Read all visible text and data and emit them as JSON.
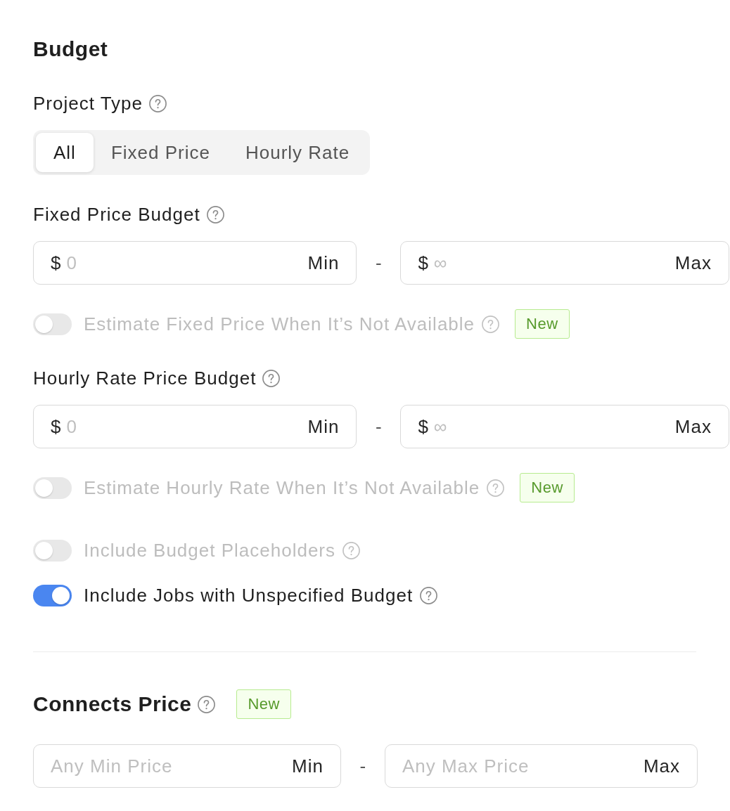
{
  "sections": [
    {
      "title": "Budget",
      "items": [
        {
          "kind": "segmented",
          "label": "Project Type",
          "help": true,
          "tabs": [
            {
              "label": "All",
              "selected": true
            },
            {
              "label": "Fixed Price",
              "selected": false
            },
            {
              "label": "Hourly Rate",
              "selected": false
            }
          ]
        },
        {
          "kind": "range",
          "label": "Fixed Price Budget",
          "help": true,
          "min": {
            "prefix": "$",
            "placeholder": "0",
            "suffix": "Min"
          },
          "separator": "-",
          "max": {
            "prefix": "$",
            "placeholder": "∞",
            "suffix": "Max"
          },
          "toggle": {
            "label": "Estimate Fixed Price When It’s Not Available",
            "help": true,
            "on": false,
            "badge": "New"
          }
        },
        {
          "kind": "range",
          "label": "Hourly Rate Price Budget",
          "help": true,
          "min": {
            "prefix": "$",
            "placeholder": "0",
            "suffix": "Min"
          },
          "separator": "-",
          "max": {
            "prefix": "$",
            "placeholder": "∞",
            "suffix": "Max"
          },
          "toggle": {
            "label": "Estimate Hourly Rate When It’s Not Available",
            "help": true,
            "on": false,
            "badge": "New"
          }
        },
        {
          "kind": "toggle",
          "label": "Include Budget Placeholders",
          "help": true,
          "on": false
        },
        {
          "kind": "toggle",
          "label": "Include Jobs with Unspecified Budget",
          "help": true,
          "on": true
        }
      ]
    },
    {
      "title": "Connects Price",
      "help": true,
      "badge": "New",
      "items": [
        {
          "kind": "range",
          "min": {
            "placeholder": "Any Min Price",
            "suffix": "Min"
          },
          "separator": "-",
          "max": {
            "placeholder": "Any Max Price",
            "suffix": "Max"
          }
        }
      ]
    }
  ]
}
